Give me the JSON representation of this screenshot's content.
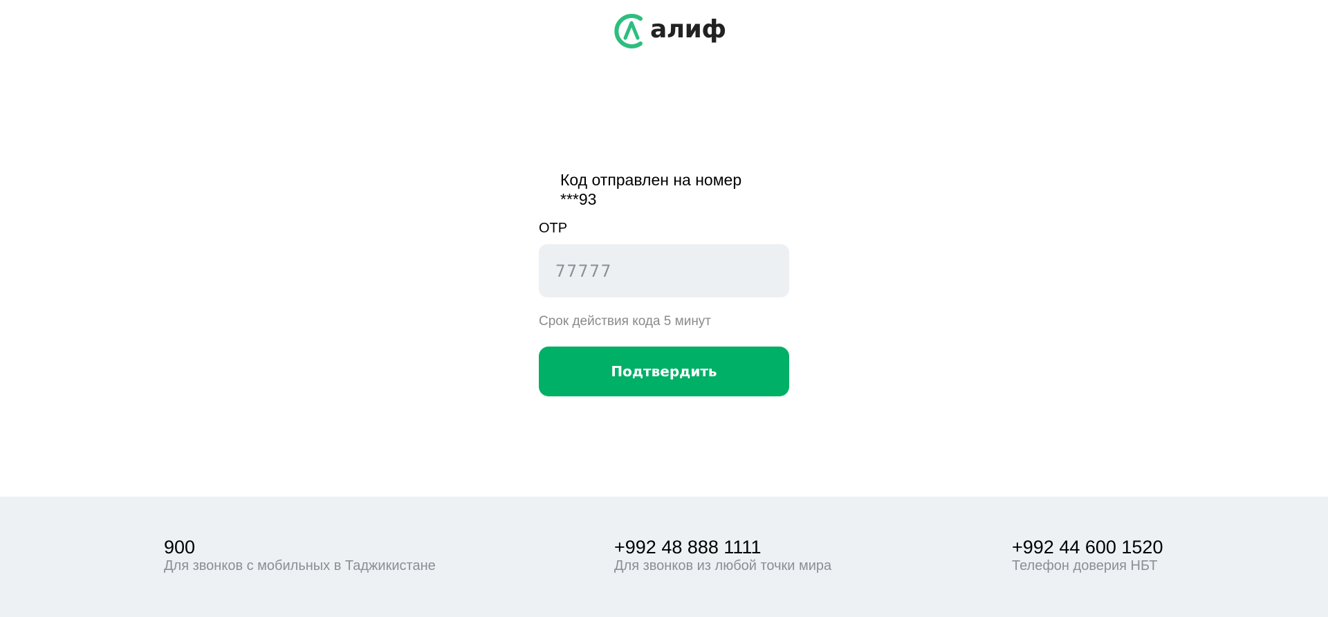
{
  "brand": {
    "name": "алиф",
    "accent_color": "#2dbe7e"
  },
  "form": {
    "sent_message": "Код отправлен на номер ***93",
    "otp_label": "OTP",
    "otp_placeholder": "77777",
    "otp_value": "",
    "expiry_hint": "Срок действия кода 5 минут",
    "confirm_label": "Подтвердить",
    "button_color": "#00b066"
  },
  "footer": {
    "contacts": [
      {
        "number": "900",
        "description": "Для звонков с мобильных в Таджикистане"
      },
      {
        "number": "+992 48 888 1111",
        "description": "Для звонков из любой точки мира"
      },
      {
        "number": "+992 44 600 1520",
        "description": "Телефон доверия НБТ"
      }
    ]
  }
}
